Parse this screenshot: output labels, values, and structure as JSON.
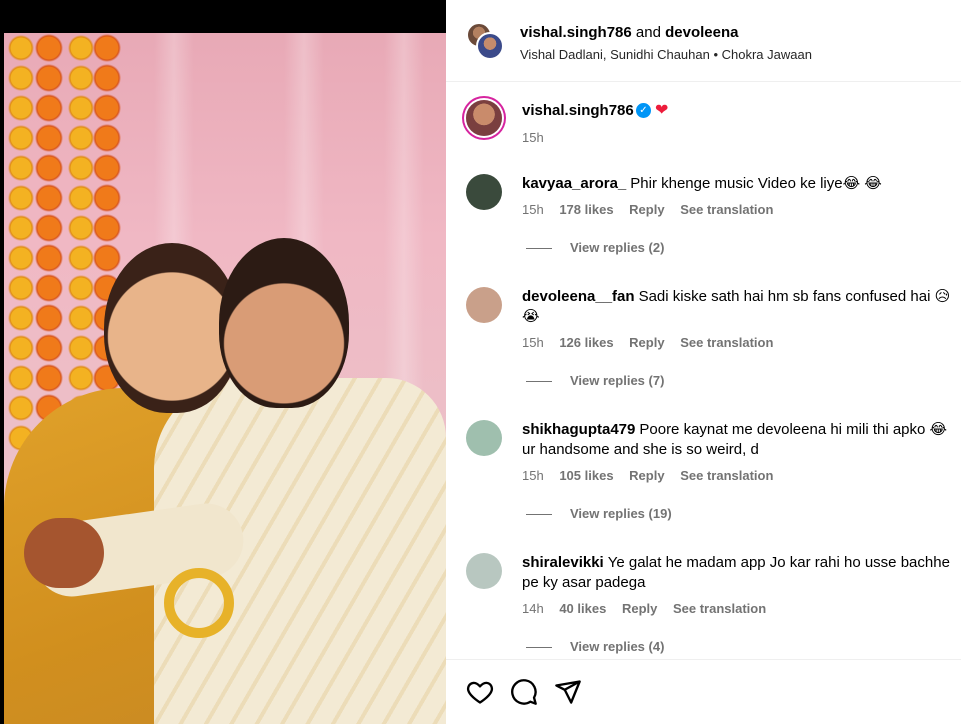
{
  "header": {
    "user1": "vishal.singh786",
    "conjunction": "and",
    "user2": "devoleena",
    "audio": "Vishal Dadlani, Sunidhi Chauhan • Chokra Jawaan"
  },
  "caption": {
    "username": "vishal.singh786",
    "verified_icon": "✓",
    "heart": "❤",
    "time": "15h"
  },
  "comments": [
    {
      "username": "kavyaa_arora_",
      "text": "Phir khenge music Video ke liye😂 😂",
      "time": "15h",
      "likes": "178 likes",
      "reply": "Reply",
      "translate": "See translation",
      "view_replies": "View replies (2)",
      "avatar_color": "#3a4a3c"
    },
    {
      "username": "devoleena__fan",
      "text": "Sadi kiske sath hai hm sb fans confused hai 😥 😭",
      "time": "15h",
      "likes": "126 likes",
      "reply": "Reply",
      "translate": "See translation",
      "view_replies": "View replies (7)",
      "avatar_color": "#c9a08a"
    },
    {
      "username": "shikhagupta479",
      "text": "Poore kaynat me devoleena hi mili thi apko 😂 ur handsome and she is so weird, d",
      "time": "15h",
      "likes": "105 likes",
      "reply": "Reply",
      "translate": "See translation",
      "view_replies": "View replies (19)",
      "avatar_color": "#9fbfae"
    },
    {
      "username": "shiralevikki",
      "text": "Ye galat he madam app Jo kar rahi ho usse bachhe pe ky asar padega",
      "time": "14h",
      "likes": "40 likes",
      "reply": "Reply",
      "translate": "See translation",
      "view_replies": "View replies (4)",
      "avatar_color": "#b8c7c0"
    }
  ],
  "actions": {
    "like_icon": "heart-outline-icon",
    "comment_icon": "comment-icon",
    "share_icon": "share-icon"
  }
}
